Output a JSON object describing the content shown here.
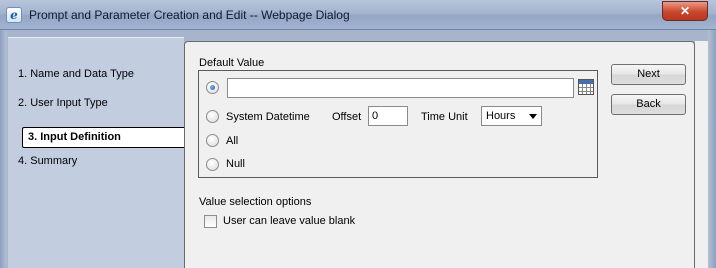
{
  "window": {
    "title": "Prompt and Parameter Creation and Edit -- Webpage Dialog",
    "app_icon": "ie-icon",
    "close_label": "✕"
  },
  "nav": {
    "items": [
      {
        "label": "1. Name and Data Type"
      },
      {
        "label": "2. User Input Type"
      },
      {
        "label": "3. Input Definition",
        "active": true
      },
      {
        "label": "4. Summary"
      }
    ]
  },
  "default_value": {
    "heading": "Default Value",
    "value_input": "",
    "options": {
      "custom": {
        "selected": true
      },
      "system_datetime": {
        "label": "System Datetime",
        "selected": false
      },
      "all": {
        "label": "All",
        "selected": false
      },
      "null": {
        "label": "Null",
        "selected": false
      }
    },
    "offset_label": "Offset",
    "offset_value": "0",
    "time_unit_label": "Time Unit",
    "time_unit_value": "Hours",
    "calendar_icon": "calendar-icon"
  },
  "value_selection": {
    "heading": "Value selection options",
    "blank_label": "User can leave value blank",
    "blank_checked": false
  },
  "buttons": {
    "next": "Next",
    "back": "Back"
  }
}
